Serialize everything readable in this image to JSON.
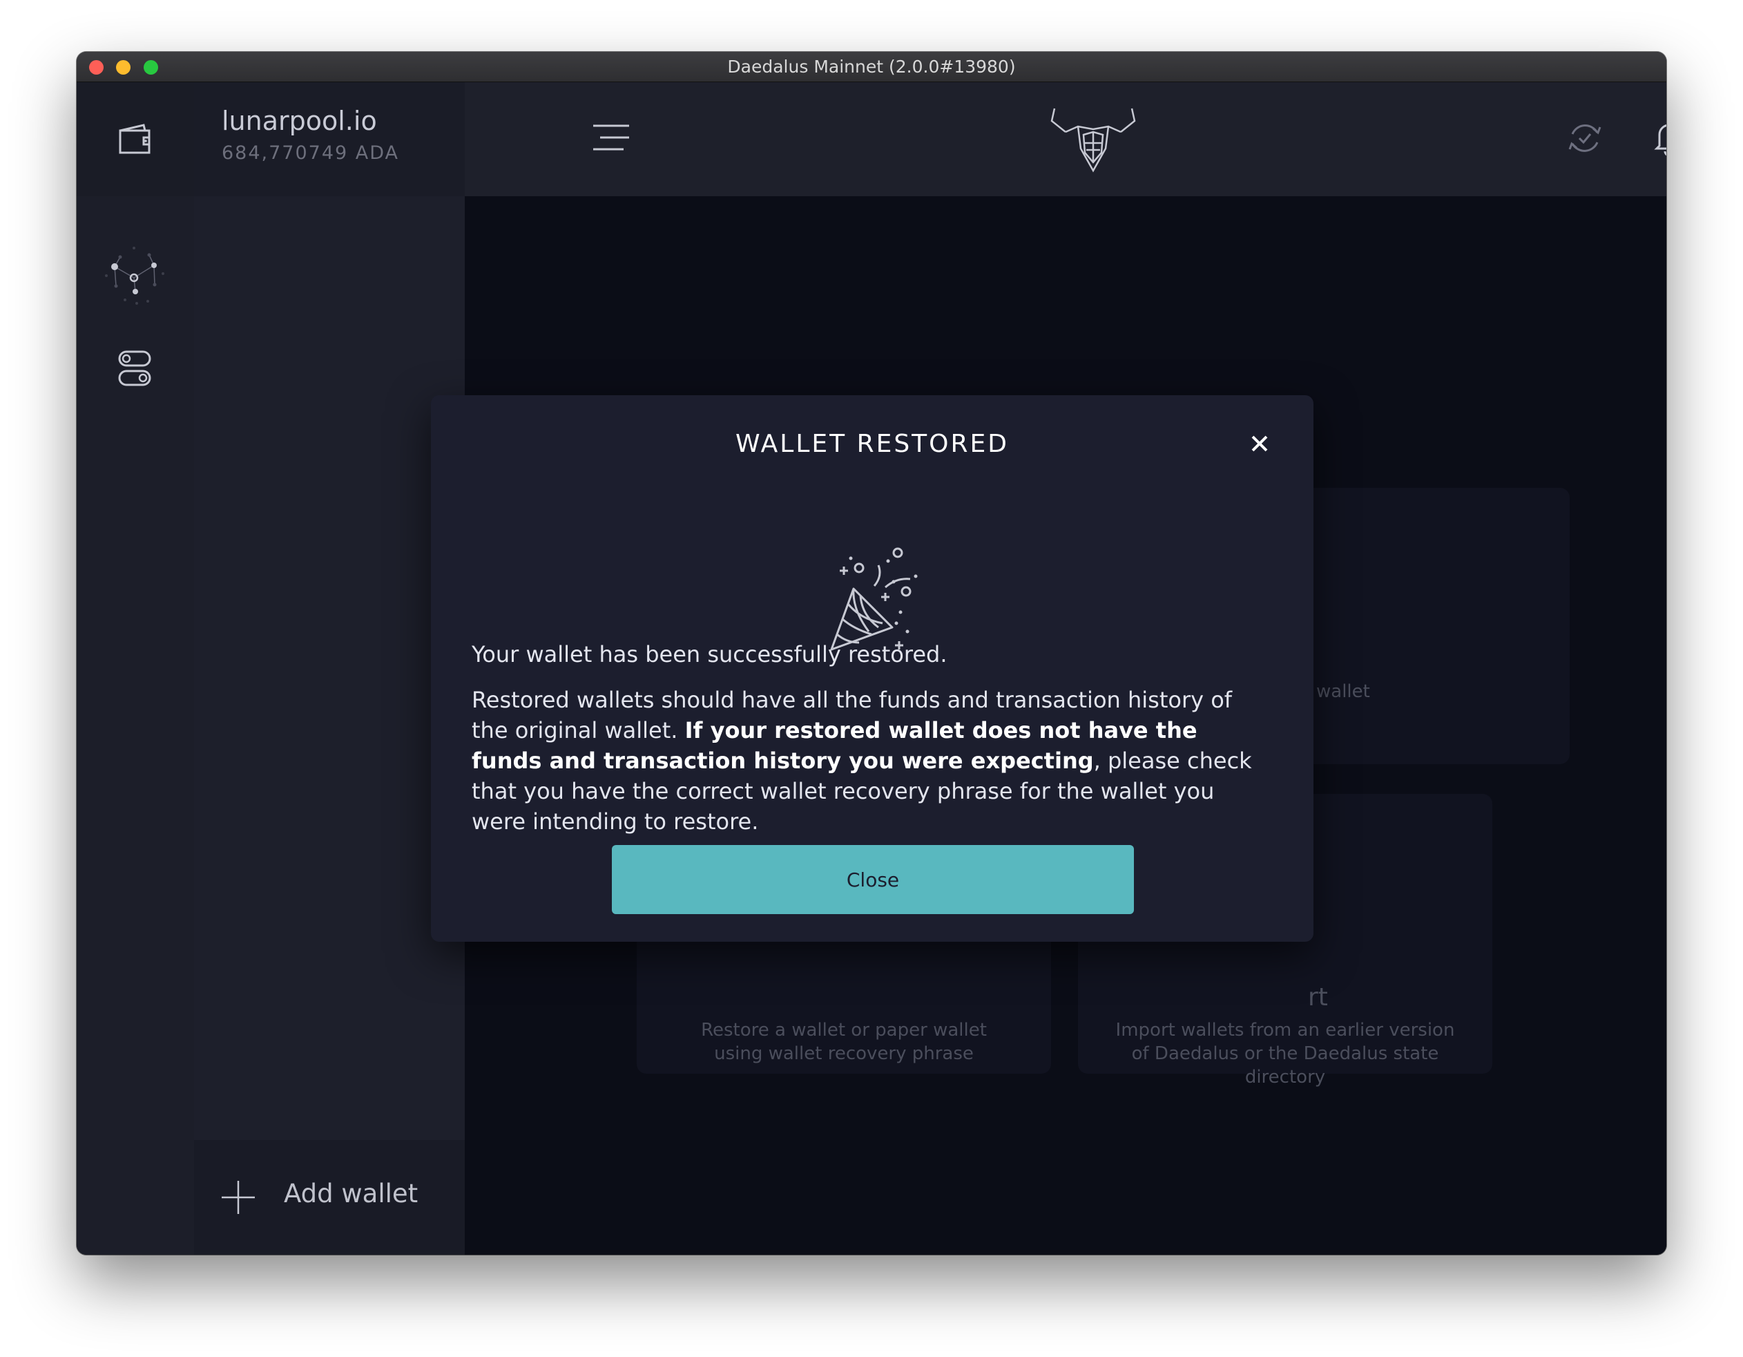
{
  "window": {
    "title": "Daedalus Mainnet (2.0.0#13980)"
  },
  "header": {
    "wallet_name": "lunarpool.io",
    "wallet_balance": "684,770749 ADA"
  },
  "wallet_panel": {
    "add_wallet_label": "Add wallet"
  },
  "background_cards": {
    "card1_partial_text": "wallet",
    "card2_desc": "Restore a wallet or paper wallet using wallet recovery phrase",
    "card3_title_partial": "rt",
    "card3_desc": "Import wallets from an earlier version of Daedalus or the Daedalus state directory"
  },
  "modal": {
    "title": "WALLET RESTORED",
    "paragraph1": "Your wallet has been successfully restored.",
    "paragraph2_part1": "Restored wallets should have all the funds and transaction history of the original wallet. ",
    "paragraph2_bold": "If your restored wallet does not have the funds and transaction history you were expecting",
    "paragraph2_part2": ", please check that you have the correct wallet recovery phrase for the wallet you were intending to restore.",
    "close_button": "Close"
  },
  "colors": {
    "accent": "#59b8bf",
    "notification_dot": "#e04545"
  },
  "icons": {
    "nav_wallet": "wallet-icon",
    "nav_staking": "staking-network-icon",
    "nav_settings": "toggle-settings-icon",
    "menu": "hamburger-menu-icon",
    "logo": "daedalus-bull-logo-icon",
    "sync": "sync-check-icon",
    "notification": "bell-icon",
    "celebration": "party-popper-icon",
    "close": "close-icon",
    "add": "plus-icon"
  }
}
